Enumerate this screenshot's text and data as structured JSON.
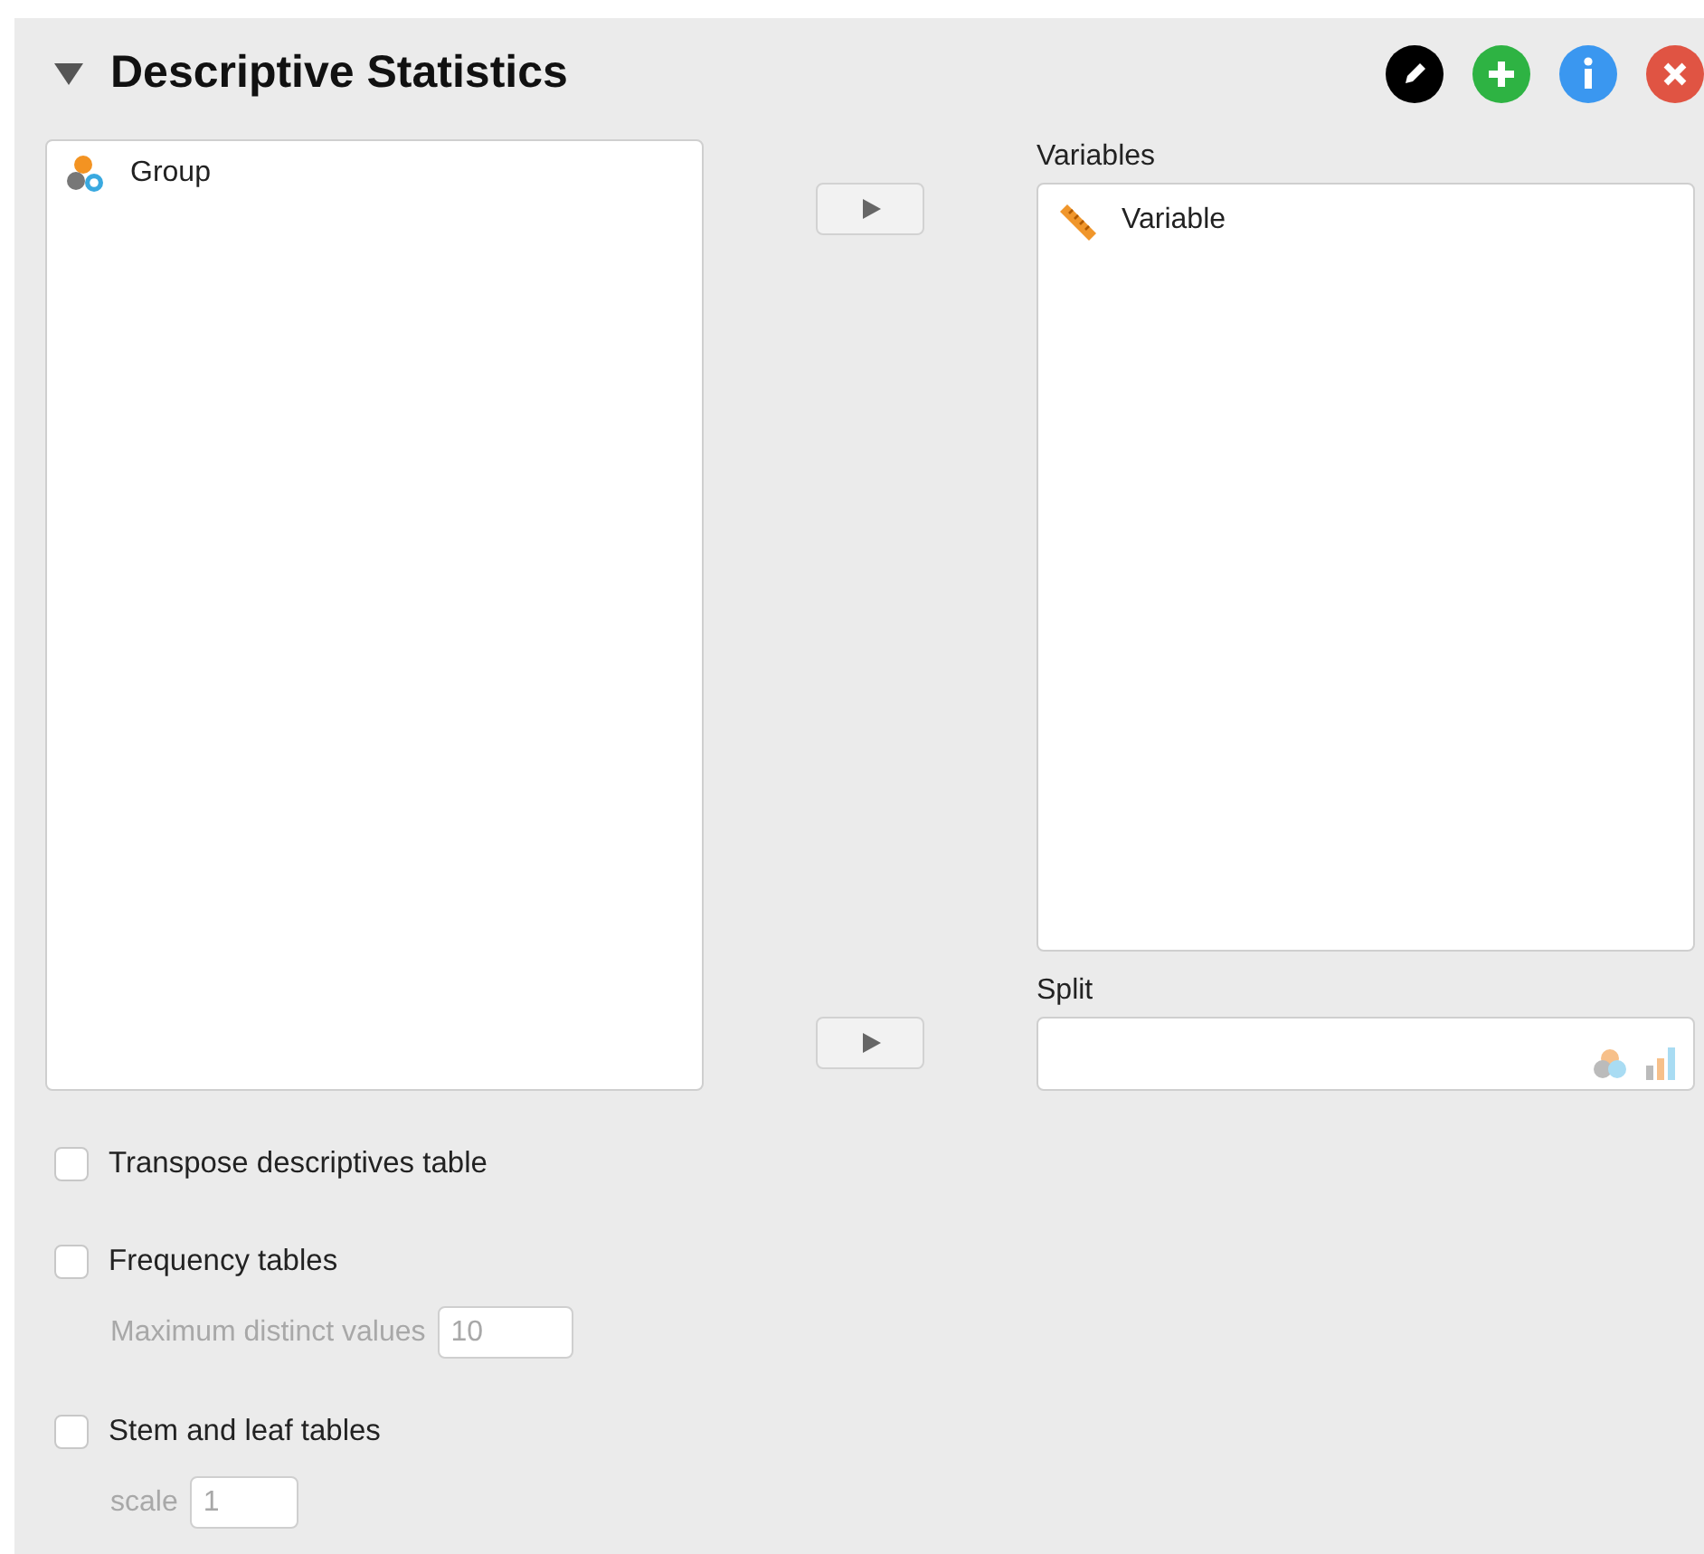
{
  "header": {
    "title": "Descriptive Statistics",
    "expanded": true
  },
  "header_buttons": [
    {
      "kind": "edit"
    },
    {
      "kind": "add"
    },
    {
      "kind": "info"
    },
    {
      "kind": "close"
    }
  ],
  "source_list": {
    "items": [
      {
        "label": "Group",
        "kind": "nominal"
      }
    ]
  },
  "variables": {
    "label": "Variables",
    "items": [
      {
        "label": "Variable",
        "kind": "scale"
      }
    ]
  },
  "split": {
    "label": "Split"
  },
  "options": [
    {
      "label": "Transpose descriptives table",
      "checked": false
    },
    {
      "label": "Frequency tables",
      "checked": false,
      "field": {
        "label": "Maximum distinct values",
        "value": "10",
        "disabled": true
      }
    },
    {
      "label": "Stem and leaf tables",
      "checked": false,
      "field": {
        "label": "scale",
        "value": "1",
        "disabled": true
      }
    }
  ]
}
